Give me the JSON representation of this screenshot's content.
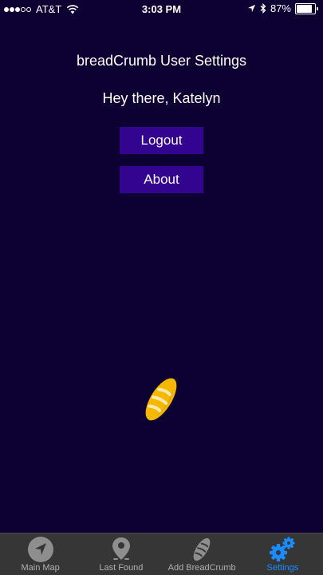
{
  "status_bar": {
    "carrier": "AT&T",
    "time": "3:03 PM",
    "battery_percent": "87%",
    "battery_level": 0.87,
    "signal_bars": 3,
    "signal_total": 5
  },
  "settings": {
    "title": "breadCrumb User Settings",
    "greeting": "Hey there, Katelyn",
    "logout_label": "Logout",
    "about_label": "About"
  },
  "tab_bar": {
    "tabs": [
      {
        "label": "Main Map",
        "icon": "navigation-arrow-icon",
        "active": false
      },
      {
        "label": "Last Found",
        "icon": "map-pin-icon",
        "active": false
      },
      {
        "label": "Add BreadCrumb",
        "icon": "bread-icon",
        "active": false
      },
      {
        "label": "Settings",
        "icon": "gears-icon",
        "active": true
      }
    ]
  },
  "colors": {
    "background": "#0d0033",
    "button": "#33048f",
    "tab_bar": "#363636",
    "active_tab": "#1a8cff",
    "inactive_icon": "#8e8e8e",
    "bread": "#f5b800"
  }
}
